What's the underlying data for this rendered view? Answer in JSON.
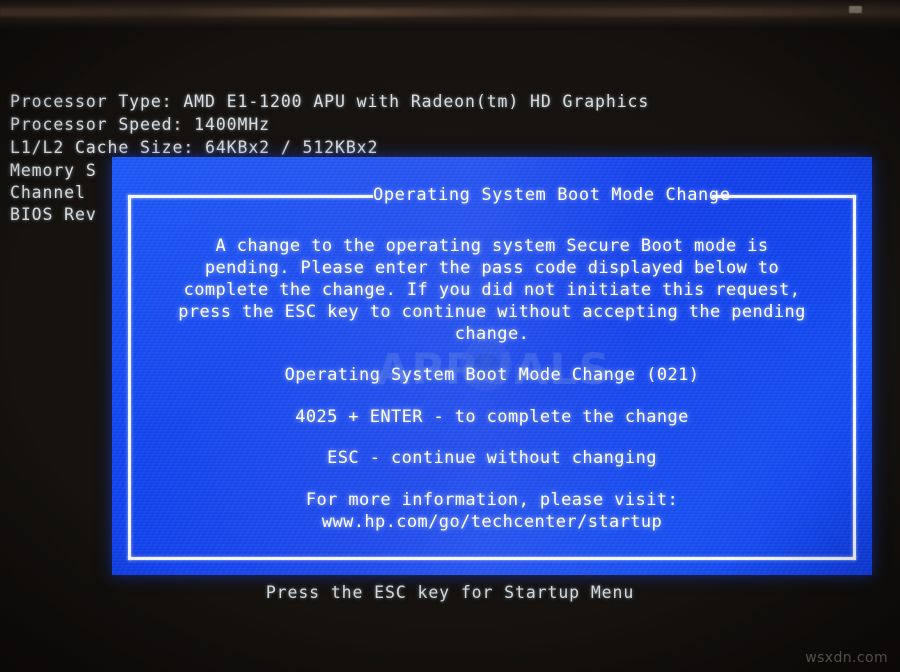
{
  "screen": {
    "post_lines": [
      "Processor Type: AMD E1-1200 APU with Radeon(tm) HD Graphics",
      "Processor Speed: 1400MHz",
      "L1/L2 Cache Size: 64KBx2 / 512KBx2",
      "Memory S",
      "Channel",
      "BIOS Rev"
    ],
    "bottom_hint": "Press the ESC key for Startup Menu"
  },
  "dialog": {
    "title": "Operating System Boot Mode Change",
    "body_lines": [
      "A change to the operating system Secure Boot mode is",
      "pending. Please enter the pass code displayed below to",
      "complete the change. If you did not initiate this request,",
      "press the ESC key to continue without accepting the pending",
      "change."
    ],
    "code_title": "Operating System Boot Mode Change (021)",
    "enter_line": "4025 + ENTER - to complete the change",
    "esc_line": "ESC - continue without changing",
    "info_lines": [
      "For more information, please visit:",
      "www.hp.com/go/techcenter/startup"
    ]
  },
  "watermark": {
    "brand": "APPUALS",
    "site": "wsxdn.com"
  },
  "colors": {
    "dialog_blue": "#0f41ec",
    "dialog_frame": "#f4f7fa",
    "post_text": "#d9dde0",
    "screen_black": "#15120f"
  }
}
